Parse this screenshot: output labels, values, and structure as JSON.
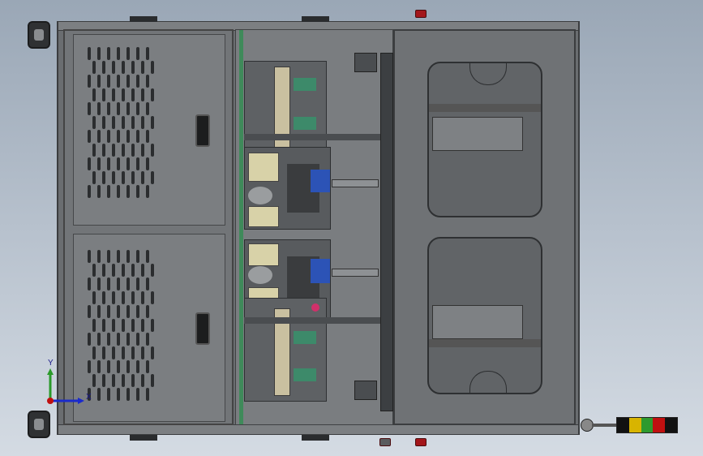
{
  "view": {
    "background_top": "#9aa7b6",
    "background_bottom": "#d4dbe3",
    "frame_color": "#6a6d70"
  },
  "triad": {
    "y_label": "Y",
    "x_label": "X"
  },
  "stack_light": {
    "colors": [
      "#111111",
      "#d8b400",
      "#2e9a2e",
      "#c01010",
      "#111111"
    ]
  },
  "icons": [
    "caster-icon",
    "door-handle-icon",
    "triad-icon",
    "stack-light-icon",
    "motor-icon"
  ]
}
